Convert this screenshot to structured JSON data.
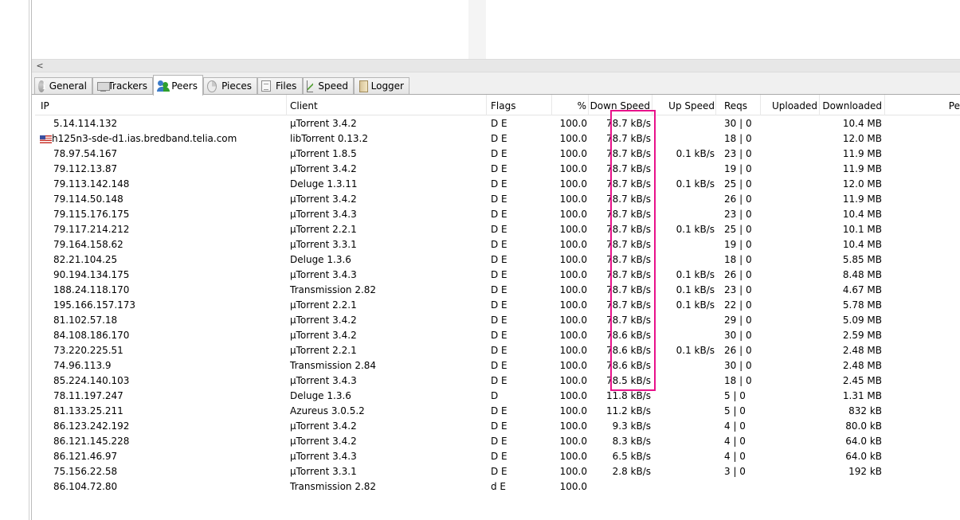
{
  "tabs": [
    {
      "label": "General",
      "icon": "info-icon"
    },
    {
      "label": "Trackers",
      "icon": "trackers-icon"
    },
    {
      "label": "Peers",
      "icon": "peers-icon"
    },
    {
      "label": "Pieces",
      "icon": "pieces-icon"
    },
    {
      "label": "Files",
      "icon": "files-icon"
    },
    {
      "label": "Speed",
      "icon": "speed-icon"
    },
    {
      "label": "Logger",
      "icon": "logger-icon"
    }
  ],
  "active_tab": "Peers",
  "scroll_left_arrow": "<",
  "columns": {
    "ip": "IP",
    "client": "Client",
    "flags": "Flags",
    "percent": "%",
    "down_speed": "Down Speed",
    "up_speed": "Up Speed",
    "reqs": "Reqs",
    "uploaded": "Uploaded",
    "downloaded": "Downloaded",
    "peer_dl": "Pe"
  },
  "peers": [
    {
      "ip": "5.14.114.132",
      "client": "µTorrent 3.4.2",
      "flags": "D E",
      "percent": "100.0",
      "down": "78.7 kB/s",
      "up": "",
      "reqs": "30 | 0",
      "downloaded": "10.4 MB"
    },
    {
      "ip": "h125n3-sde-d1.ias.bredband.telia.com",
      "country": "us-flag-icon",
      "client": "libTorrent 0.13.2",
      "flags": "D E",
      "percent": "100.0",
      "down": "78.7 kB/s",
      "up": "",
      "reqs": "18 | 0",
      "downloaded": "12.0 MB"
    },
    {
      "ip": "78.97.54.167",
      "client": "µTorrent 1.8.5",
      "flags": "D E",
      "percent": "100.0",
      "down": "78.7 kB/s",
      "up": "0.1 kB/s",
      "reqs": "23 | 0",
      "downloaded": "11.9 MB"
    },
    {
      "ip": "79.112.13.87",
      "client": "µTorrent 3.4.2",
      "flags": "D E",
      "percent": "100.0",
      "down": "78.7 kB/s",
      "up": "",
      "reqs": "19 | 0",
      "downloaded": "11.9 MB"
    },
    {
      "ip": "79.113.142.148",
      "client": "Deluge 1.3.11",
      "flags": "D E",
      "percent": "100.0",
      "down": "78.7 kB/s",
      "up": "0.1 kB/s",
      "reqs": "25 | 0",
      "downloaded": "12.0 MB"
    },
    {
      "ip": "79.114.50.148",
      "client": "µTorrent 3.4.2",
      "flags": "D E",
      "percent": "100.0",
      "down": "78.7 kB/s",
      "up": "",
      "reqs": "26 | 0",
      "downloaded": "11.9 MB"
    },
    {
      "ip": "79.115.176.175",
      "client": "µTorrent 3.4.3",
      "flags": "D E",
      "percent": "100.0",
      "down": "78.7 kB/s",
      "up": "",
      "reqs": "23 | 0",
      "downloaded": "10.4 MB"
    },
    {
      "ip": "79.117.214.212",
      "client": "µTorrent 2.2.1",
      "flags": "D E",
      "percent": "100.0",
      "down": "78.7 kB/s",
      "up": "0.1 kB/s",
      "reqs": "25 | 0",
      "downloaded": "10.1 MB"
    },
    {
      "ip": "79.164.158.62",
      "client": "µTorrent 3.3.1",
      "flags": "D E",
      "percent": "100.0",
      "down": "78.7 kB/s",
      "up": "",
      "reqs": "19 | 0",
      "downloaded": "10.4 MB"
    },
    {
      "ip": "82.21.104.25",
      "client": "Deluge 1.3.6",
      "flags": "D E",
      "percent": "100.0",
      "down": "78.7 kB/s",
      "up": "",
      "reqs": "18 | 0",
      "downloaded": "5.85 MB"
    },
    {
      "ip": "90.194.134.175",
      "client": "µTorrent 3.4.3",
      "flags": "D E",
      "percent": "100.0",
      "down": "78.7 kB/s",
      "up": "0.1 kB/s",
      "reqs": "26 | 0",
      "downloaded": "8.48 MB"
    },
    {
      "ip": "188.24.118.170",
      "client": "Transmission 2.82",
      "flags": "D E",
      "percent": "100.0",
      "down": "78.7 kB/s",
      "up": "0.1 kB/s",
      "reqs": "23 | 0",
      "downloaded": "4.67 MB"
    },
    {
      "ip": "195.166.157.173",
      "client": "µTorrent 2.2.1",
      "flags": "D E",
      "percent": "100.0",
      "down": "78.7 kB/s",
      "up": "0.1 kB/s",
      "reqs": "22 | 0",
      "downloaded": "5.78 MB"
    },
    {
      "ip": "81.102.57.18",
      "client": "µTorrent 3.4.2",
      "flags": "D E",
      "percent": "100.0",
      "down": "78.7 kB/s",
      "up": "",
      "reqs": "29 | 0",
      "downloaded": "5.09 MB"
    },
    {
      "ip": "84.108.186.170",
      "client": "µTorrent 3.4.2",
      "flags": "D E",
      "percent": "100.0",
      "down": "78.6 kB/s",
      "up": "",
      "reqs": "30 | 0",
      "downloaded": "2.59 MB"
    },
    {
      "ip": "73.220.225.51",
      "client": "µTorrent 2.2.1",
      "flags": "D E",
      "percent": "100.0",
      "down": "78.6 kB/s",
      "up": "0.1 kB/s",
      "reqs": "26 | 0",
      "downloaded": "2.48 MB"
    },
    {
      "ip": "74.96.113.9",
      "client": "Transmission 2.84",
      "flags": "D E",
      "percent": "100.0",
      "down": "78.6 kB/s",
      "up": "",
      "reqs": "30 | 0",
      "downloaded": "2.48 MB"
    },
    {
      "ip": "85.224.140.103",
      "client": "µTorrent 3.4.3",
      "flags": "D E",
      "percent": "100.0",
      "down": "78.5 kB/s",
      "up": "",
      "reqs": "18 | 0",
      "downloaded": "2.45 MB"
    },
    {
      "ip": "78.11.197.247",
      "client": "Deluge 1.3.6",
      "flags": "D",
      "percent": "100.0",
      "down": "11.8 kB/s",
      "up": "",
      "reqs": "5 | 0",
      "downloaded": "1.31 MB"
    },
    {
      "ip": "81.133.25.211",
      "client": "Azureus 3.0.5.2",
      "flags": "D E",
      "percent": "100.0",
      "down": "11.2 kB/s",
      "up": "",
      "reqs": "5 | 0",
      "downloaded": "832 kB"
    },
    {
      "ip": "86.123.242.192",
      "client": "µTorrent 3.4.2",
      "flags": "D E",
      "percent": "100.0",
      "down": "9.3 kB/s",
      "up": "",
      "reqs": "4 | 0",
      "downloaded": "80.0 kB"
    },
    {
      "ip": "86.121.145.228",
      "client": "µTorrent 3.4.2",
      "flags": "D E",
      "percent": "100.0",
      "down": "8.3 kB/s",
      "up": "",
      "reqs": "4 | 0",
      "downloaded": "64.0 kB"
    },
    {
      "ip": "86.121.46.97",
      "client": "µTorrent 3.4.3",
      "flags": "D E",
      "percent": "100.0",
      "down": "6.5 kB/s",
      "up": "",
      "reqs": "4 | 0",
      "downloaded": "64.0 kB"
    },
    {
      "ip": "75.156.22.58",
      "client": "µTorrent 3.3.1",
      "flags": "D E",
      "percent": "100.0",
      "down": "2.8 kB/s",
      "up": "",
      "reqs": "3 | 0",
      "downloaded": "192 kB"
    },
    {
      "ip": "86.104.72.80",
      "client": "Transmission 2.82",
      "flags": "d E",
      "percent": "100.0",
      "down": "",
      "up": "",
      "reqs": "",
      "downloaded": ""
    }
  ],
  "colors": {
    "highlight": "#e8128a",
    "sorted_column_bg": "#f3f3f3",
    "tab_bg": "#f0f0f0"
  }
}
